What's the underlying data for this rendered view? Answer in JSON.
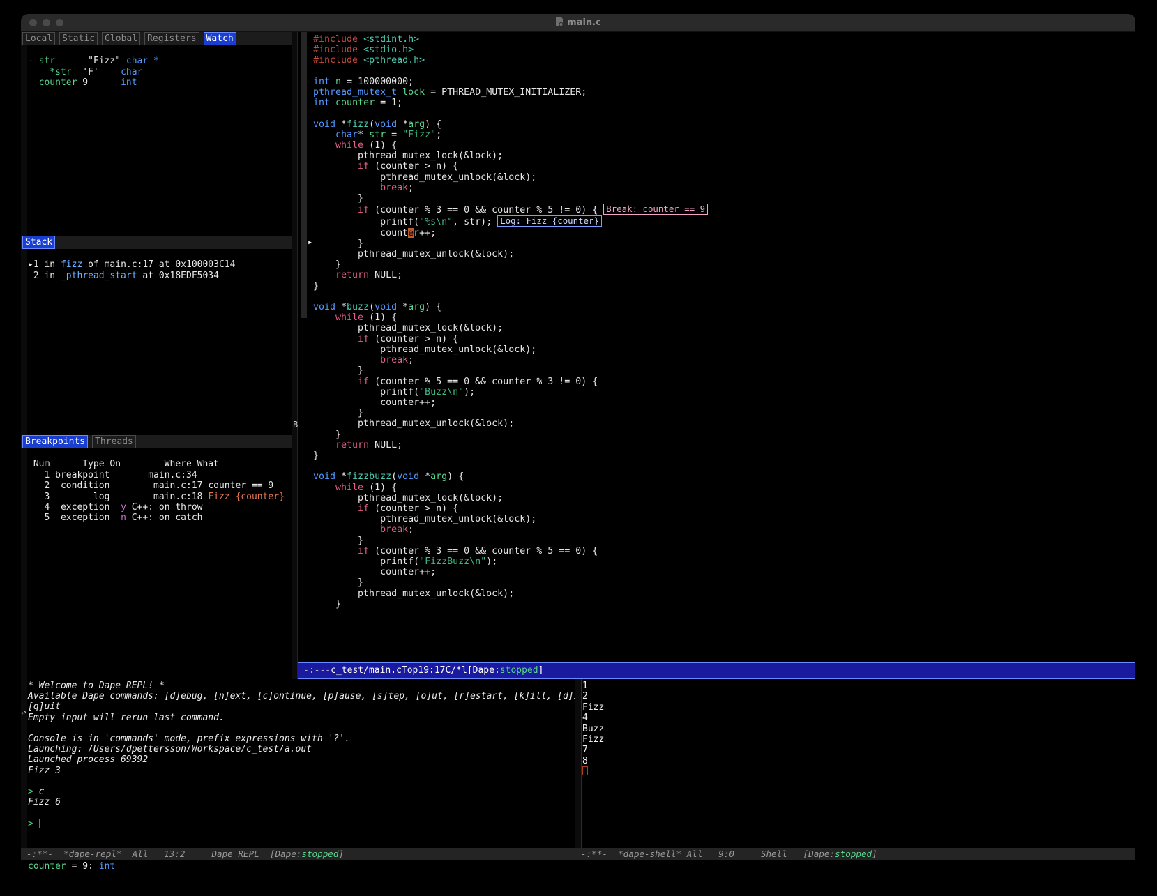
{
  "window": {
    "title": "main.c",
    "file_icon": "file-icon",
    "traffic_lights": [
      "close",
      "minimize",
      "zoom"
    ]
  },
  "watch_panel": {
    "tabs": [
      {
        "label": "Local",
        "active": false
      },
      {
        "label": "Static",
        "active": false
      },
      {
        "label": "Global",
        "active": false
      },
      {
        "label": "Registers",
        "active": false
      },
      {
        "label": "Watch",
        "active": true
      }
    ],
    "rows": [
      {
        "expander": "-",
        "name": "str",
        "value": "\"Fizz\"",
        "type": "char *"
      },
      {
        "expander": "",
        "name": "*str",
        "value": "'F'",
        "type": "char"
      },
      {
        "expander": "",
        "name": "counter",
        "value": "9",
        "type": "int"
      }
    ]
  },
  "stack_panel": {
    "title": "Stack",
    "frames": [
      {
        "marker": "▸",
        "num": "1",
        "in": "in",
        "fn": "fizz",
        "of": "of main.c:17 at 0x100003C14"
      },
      {
        "marker": "",
        "num": "2",
        "in": "in",
        "fn": "_pthread_start",
        "of": "at 0x18EDF5034"
      }
    ]
  },
  "breakpoints_panel": {
    "tabs": [
      {
        "label": "Breakpoints",
        "active": true
      },
      {
        "label": "Threads",
        "active": false
      }
    ],
    "headers": [
      "Num",
      "Type",
      "On",
      "Where",
      "What"
    ],
    "header_line": " Num      Type On        Where What",
    "rows": [
      {
        "num": "1",
        "type": "breakpoint",
        "on": "",
        "where": "main.c:34",
        "what": ""
      },
      {
        "num": "2",
        "type": "condition",
        "on": "",
        "where": "main.c:17",
        "what": "counter == 9"
      },
      {
        "num": "3",
        "type": "log",
        "on": "",
        "where": "main.c:18",
        "what": "Fizz {counter}"
      },
      {
        "num": "4",
        "type": "exception",
        "on": "y",
        "where": "C++: on throw",
        "what": ""
      },
      {
        "num": "5",
        "type": "exception",
        "on": "n",
        "where": "C++: on catch",
        "what": ""
      }
    ]
  },
  "editor": {
    "breakpoint_arrow": "▸",
    "inline_break_badge": "Break: counter == 9",
    "inline_log_badge": "Log: Fizz {counter}",
    "code_lines": [
      "#include <stdint.h>",
      "#include <stdio.h>",
      "#include <pthread.h>",
      "",
      "int n = 100000000;",
      "pthread_mutex_t lock = PTHREAD_MUTEX_INITIALIZER;",
      "int counter = 1;",
      "",
      "void *fizz(void *arg) {",
      "    char* str = \"Fizz\";",
      "    while (1) {",
      "        pthread_mutex_lock(&lock);",
      "        if (counter > n) {",
      "            pthread_mutex_unlock(&lock);",
      "            break;",
      "        }",
      "        if (counter % 3 == 0 && counter % 5 != 0) {",
      "            printf(\"%s\\n\", str);",
      "            counter++;",
      "        }",
      "        pthread_mutex_unlock(&lock);",
      "    }",
      "    return NULL;",
      "}",
      "",
      "void *buzz(void *arg) {",
      "    while (1) {",
      "        pthread_mutex_lock(&lock);",
      "        if (counter > n) {",
      "            pthread_mutex_unlock(&lock);",
      "            break;",
      "        }",
      "        if (counter % 5 == 0 && counter % 3 != 0) {",
      "            printf(\"Buzz\\n\");",
      "            counter++;",
      "        }",
      "        pthread_mutex_unlock(&lock);",
      "    }",
      "    return NULL;",
      "}",
      "",
      "void *fizzbuzz(void *arg) {",
      "    while (1) {",
      "        pthread_mutex_lock(&lock);",
      "        if (counter > n) {",
      "            pthread_mutex_unlock(&lock);",
      "            break;",
      "        }",
      "        if (counter % 3 == 0 && counter % 5 == 0) {",
      "            printf(\"FizzBuzz\\n\");",
      "            counter++;",
      "        }",
      "        pthread_mutex_unlock(&lock);",
      "    }"
    ],
    "modeline": {
      "left": "-:---",
      "buffer": "c_test/main.c",
      "position_label": "Top",
      "line_col": "19:17",
      "major_mode": "C/*l",
      "status_prefix": "[Dape:",
      "status_value": "stopped",
      "status_suffix": "]"
    }
  },
  "repl": {
    "divider_mark": "↩",
    "lines": [
      "* Welcome to Dape REPL! *",
      "Available Dape commands: [d]ebug, [n]ext, [c]ontinue, [p]ause, [s]tep, [o]ut, [r]estart, [k]ill, [d]isconnect, \\",
      "[q]uit",
      "Empty input will rerun last command.",
      "",
      "Console is in 'commands' mode, prefix expressions with '?'.",
      "Launching: /Users/dpettersson/Workspace/c_test/a.out",
      "Launched process 69392",
      "Fizz 3",
      ""
    ],
    "entries": [
      {
        "prompt": "> ",
        "input": "c"
      },
      {
        "prompt": "",
        "input": "Fizz 6"
      }
    ],
    "current_prompt": "> ",
    "modeline": {
      "left": "-:**-",
      "buffer": "*dape-repl*",
      "position_label": "All",
      "line_col": "13:2",
      "major_mode": "Dape REPL",
      "status_prefix": "[Dape:",
      "status_value": "stopped",
      "status_suffix": "]"
    }
  },
  "shell": {
    "output_lines": [
      "1",
      "2",
      "Fizz",
      "4",
      "Buzz",
      "Fizz",
      "7",
      "8"
    ],
    "modeline": {
      "left": "-:**-",
      "buffer": "*dape-shell*",
      "position_label": "All",
      "line_col": "9:0",
      "major_mode": "Shell",
      "status_prefix": "[Dape:",
      "status_value": "stopped",
      "status_suffix": "]"
    }
  },
  "minibuffer": {
    "expr": "counter",
    "eq": " = ",
    "value": "9",
    "colon": ": ",
    "type": "int"
  },
  "colors": {
    "accent_blue": "#1a3fd0",
    "modeline_blue": "#1a1a9e",
    "green": "#57d68d",
    "type_blue": "#5599ff",
    "keyword_pink": "#e05f8c",
    "string_green": "#3fb884",
    "preproc_red": "#c74b3c",
    "badge_pink": "#f5a2c8",
    "cursor_orange": "#c05a30"
  }
}
